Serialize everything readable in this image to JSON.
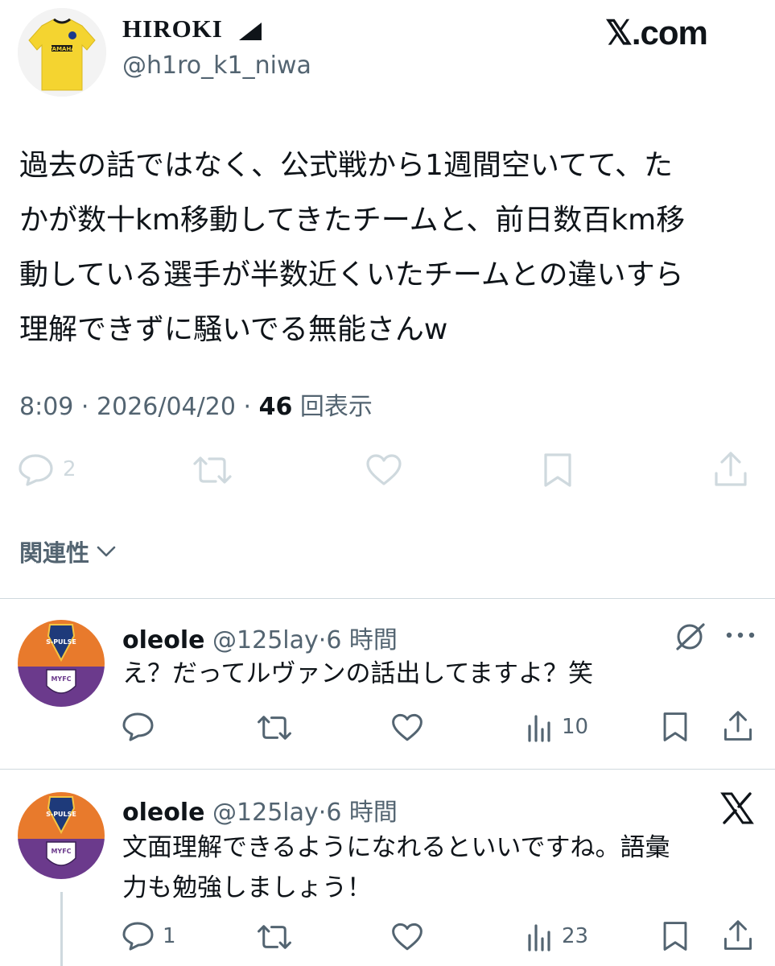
{
  "author": {
    "display_name": "HIROKI",
    "handle": "@h1ro_k1_niwa",
    "jersey_text": "YAMAHA"
  },
  "brand": "𝕏.com",
  "tweet": {
    "lines": [
      "過去の話ではなく、公式戦から1週間空いてて、た",
      "かが数十km移動してきたチームと、前日数百km移",
      "動している選手が半数近くいたチームとの違いすら",
      "理解できずに騒いでる無能さんw"
    ],
    "time": "8:09",
    "date": "2026/04/20",
    "views": "46",
    "views_label": "回表示",
    "sep": "·",
    "reply_count": "2"
  },
  "relevance_label": "関連性",
  "replies": [
    {
      "name": "oleole",
      "handle": "@125lay",
      "sep": "·",
      "time": "6 時間",
      "lines": [
        "え？だってルヴァンの話出してますよ？笑"
      ],
      "reply_count": "",
      "views": "10",
      "badge_top": "S-PULSE",
      "badge_bottom": "MYFC"
    },
    {
      "name": "oleole",
      "handle": "@125lay",
      "sep": "·",
      "time": "6 時間",
      "lines": [
        "文面理解できるようになれるといいですね。語彙",
        "力も勉強しましょう！"
      ],
      "reply_count": "1",
      "views": "23",
      "badge_top": "S-PULSE",
      "badge_bottom": "MYFC"
    }
  ],
  "colors": {
    "text": "#0f1419",
    "muted": "#536471",
    "divider": "#cfd9de",
    "action_grey": "#cfd9de",
    "orange": "#e87a2c",
    "purple": "#6b3a8c",
    "jersey": "#f4d430"
  }
}
